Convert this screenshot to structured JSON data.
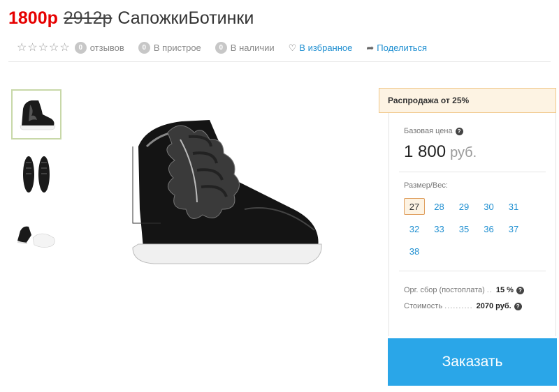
{
  "product": {
    "price_new": "1800р",
    "price_old": "2912р",
    "name": "СапожкиБотинки"
  },
  "meta": {
    "stars_count": 5,
    "reviews_count": "0",
    "reviews_label": "отзывов",
    "attached_count": "0",
    "attached_label": "В пристрое",
    "stock_count": "0",
    "stock_label": "В наличии",
    "favorites_label": "В избранное",
    "share_label": "Поделиться"
  },
  "sidebar": {
    "sale_banner": "Распродажа от 25%",
    "base_price_label": "Базовая цена",
    "base_price_value": "1 800",
    "base_price_currency": "руб.",
    "size_label": "Размер/Вес:",
    "sizes": [
      "27",
      "28",
      "29",
      "30",
      "31",
      "32",
      "33",
      "35",
      "36",
      "37",
      "38"
    ],
    "selected_size": "27",
    "org_fee_label": "Орг. сбор (постоплата)",
    "org_fee_dots": "..",
    "org_fee_value": "15 %",
    "cost_label": "Стоимость",
    "cost_dots": "..........",
    "cost_value": "2070 руб.",
    "order_button": "Заказать"
  },
  "colors": {
    "price_red": "#e60000",
    "link_blue": "#1f8fd1",
    "button_blue": "#2aa6e8",
    "sale_bg": "#fdf3e3",
    "sale_border": "#f0c789"
  }
}
